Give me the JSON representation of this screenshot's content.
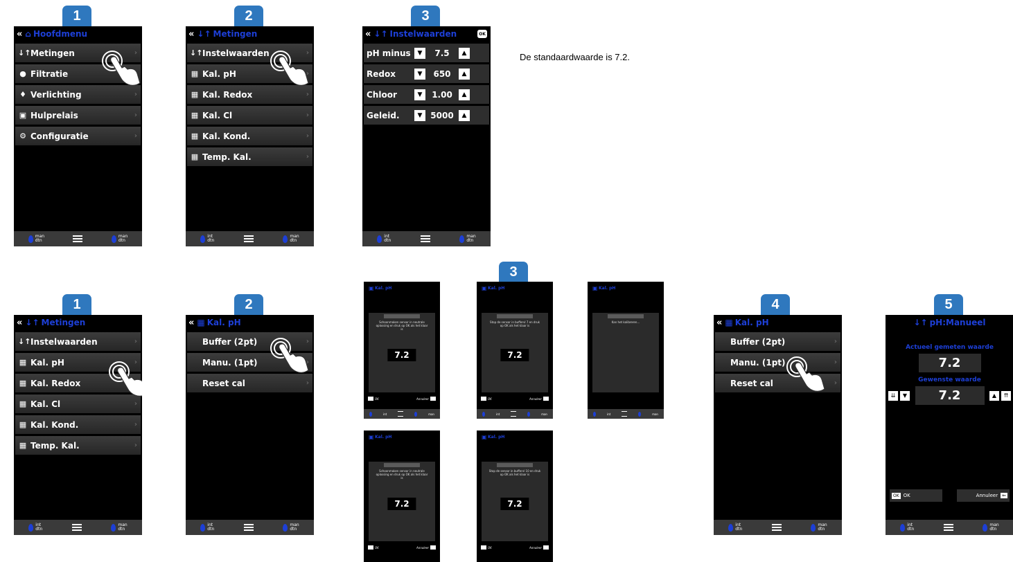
{
  "note": "De standaardwaarde is 7.2.",
  "footer": {
    "int": "int",
    "man": "man",
    "dtn": "dtn"
  },
  "row1": {
    "s1": {
      "badge": "1",
      "title": "Hoofdmenu",
      "items": [
        "Metingen",
        "Filtratie",
        "Verlichting",
        "Hulprelais",
        "Configuratie"
      ]
    },
    "s2": {
      "badge": "2",
      "title": "Metingen",
      "items": [
        "Instelwaarden",
        "Kal. pH",
        "Kal. Redox",
        "Kal. Cl",
        "Kal. Kond.",
        "Temp. Kal."
      ]
    },
    "s3": {
      "badge": "3",
      "title": "Instelwaarden",
      "ok": "OK",
      "rows": [
        {
          "label": "pH minus",
          "value": "7.5"
        },
        {
          "label": "Redox",
          "value": "650"
        },
        {
          "label": "Chloor",
          "value": "1.00"
        },
        {
          "label": "Geleid.",
          "value": "5000"
        }
      ]
    }
  },
  "row2": {
    "s1": {
      "badge": "1",
      "title": "Metingen",
      "items": [
        "Instelwaarden",
        "Kal. pH",
        "Kal. Redox",
        "Kal. Cl",
        "Kal. Kond.",
        "Temp. Kal."
      ]
    },
    "s2": {
      "badge": "2",
      "title": "Kal. pH",
      "items": [
        "Buffer (2pt)",
        "Manu. (1pt)",
        "Reset cal"
      ]
    },
    "s3": {
      "badge": "3",
      "title": "Kal. pH",
      "value": "7.2",
      "ok": "OK",
      "cancel": "Annuleer",
      "msg_a": "Schoonmaken sensor in neutrale oplossing en druk op OK als het klaar is",
      "msg_b": "Stop de sensor in buffervl 7 en druk op OK als het klaar is",
      "msg_c": "Kan het kalibreren...",
      "msg_d": "Schoonmaken sensor in neutrale oplossing en druk op OK als het klaar is",
      "msg_e": "Stop de sensor in buffervl 10 en druk op OK als het klaar is"
    },
    "s4": {
      "badge": "4",
      "title": "Kal. pH",
      "items": [
        "Buffer (2pt)",
        "Manu. (1pt)",
        "Reset cal"
      ]
    },
    "s5": {
      "badge": "5",
      "title": "pH:Manueel",
      "measured_label": "Actueel gemeten waarde",
      "measured": "7.2",
      "desired_label": "Gewenste waarde",
      "desired": "7.2",
      "ok": "OK",
      "cancel": "Annuleer"
    }
  }
}
